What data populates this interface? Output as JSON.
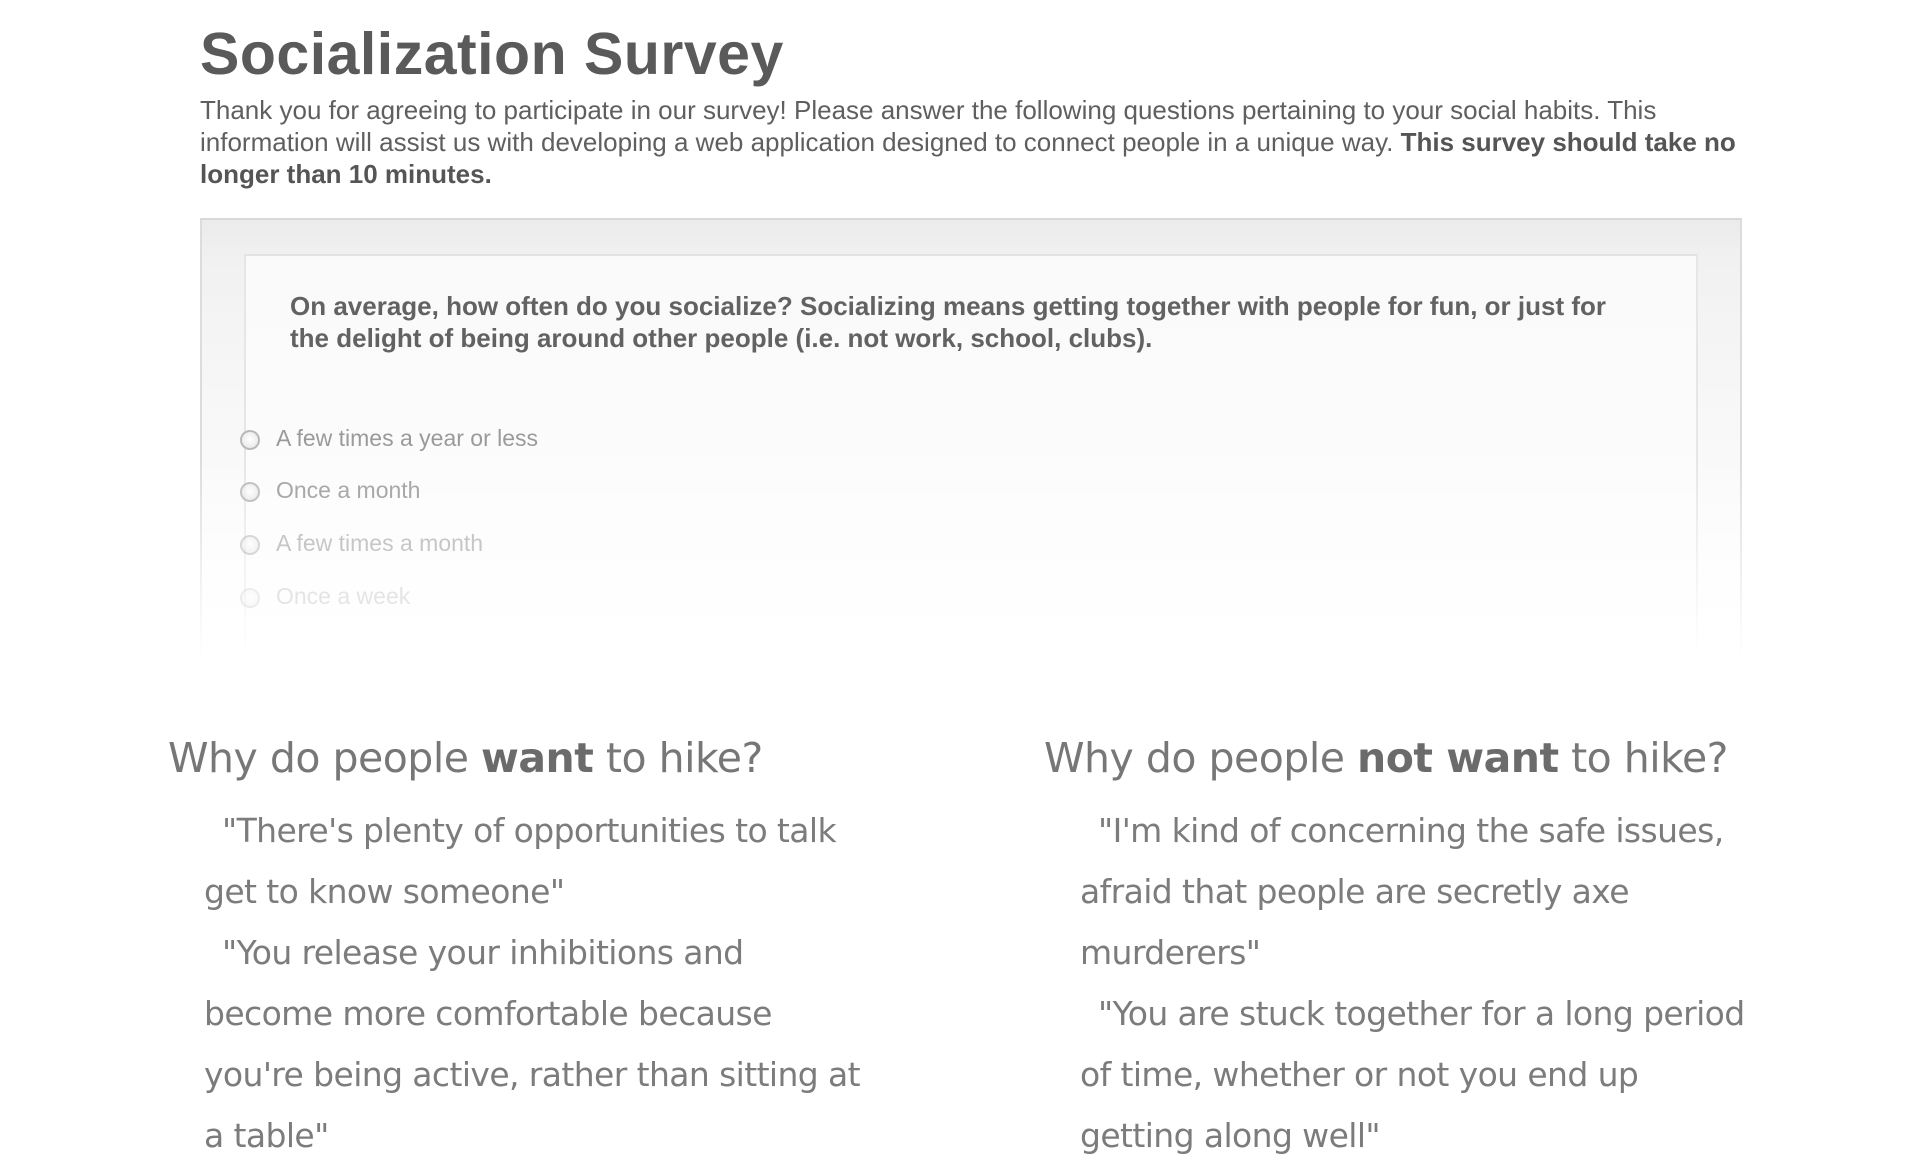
{
  "survey": {
    "title": "Socialization Survey",
    "intro": "Thank you for agreeing to participate in our survey! Please answer the following questions pertaining to your social habits. This information will assist us with developing a web application designed to connect people in a unique way.",
    "intro_bold": "This survey should take no longer than 10 minutes.",
    "question": "On average, how often do you socialize? Socializing means getting together with people for fun, or just for the delight of being around other people (i.e. not work, school, clubs).",
    "options": [
      {
        "label": "A few times a year or less"
      },
      {
        "label": "Once a month"
      },
      {
        "label": "A few times a month"
      },
      {
        "label": "Once a week"
      }
    ]
  },
  "want": {
    "heading_prefix": "Why do people",
    "heading_emphasis": "want",
    "heading_suffix": "to hike?",
    "quotes": [
      "\"There's plenty of opportunities to talk get to know someone\"",
      "\"You release your inhibitions and become more comfortable because you're being active, rather than sitting at a table\""
    ]
  },
  "not_want": {
    "heading_prefix": "Why do people",
    "heading_emphasis": "not want",
    "heading_suffix": "to hike?",
    "quotes": [
      "\"I'm kind of concerning the safe issues, afraid that people are secretly axe murderers\"",
      "\"You are stuck together for a long period of time, whether or not you end up getting along well\""
    ]
  }
}
